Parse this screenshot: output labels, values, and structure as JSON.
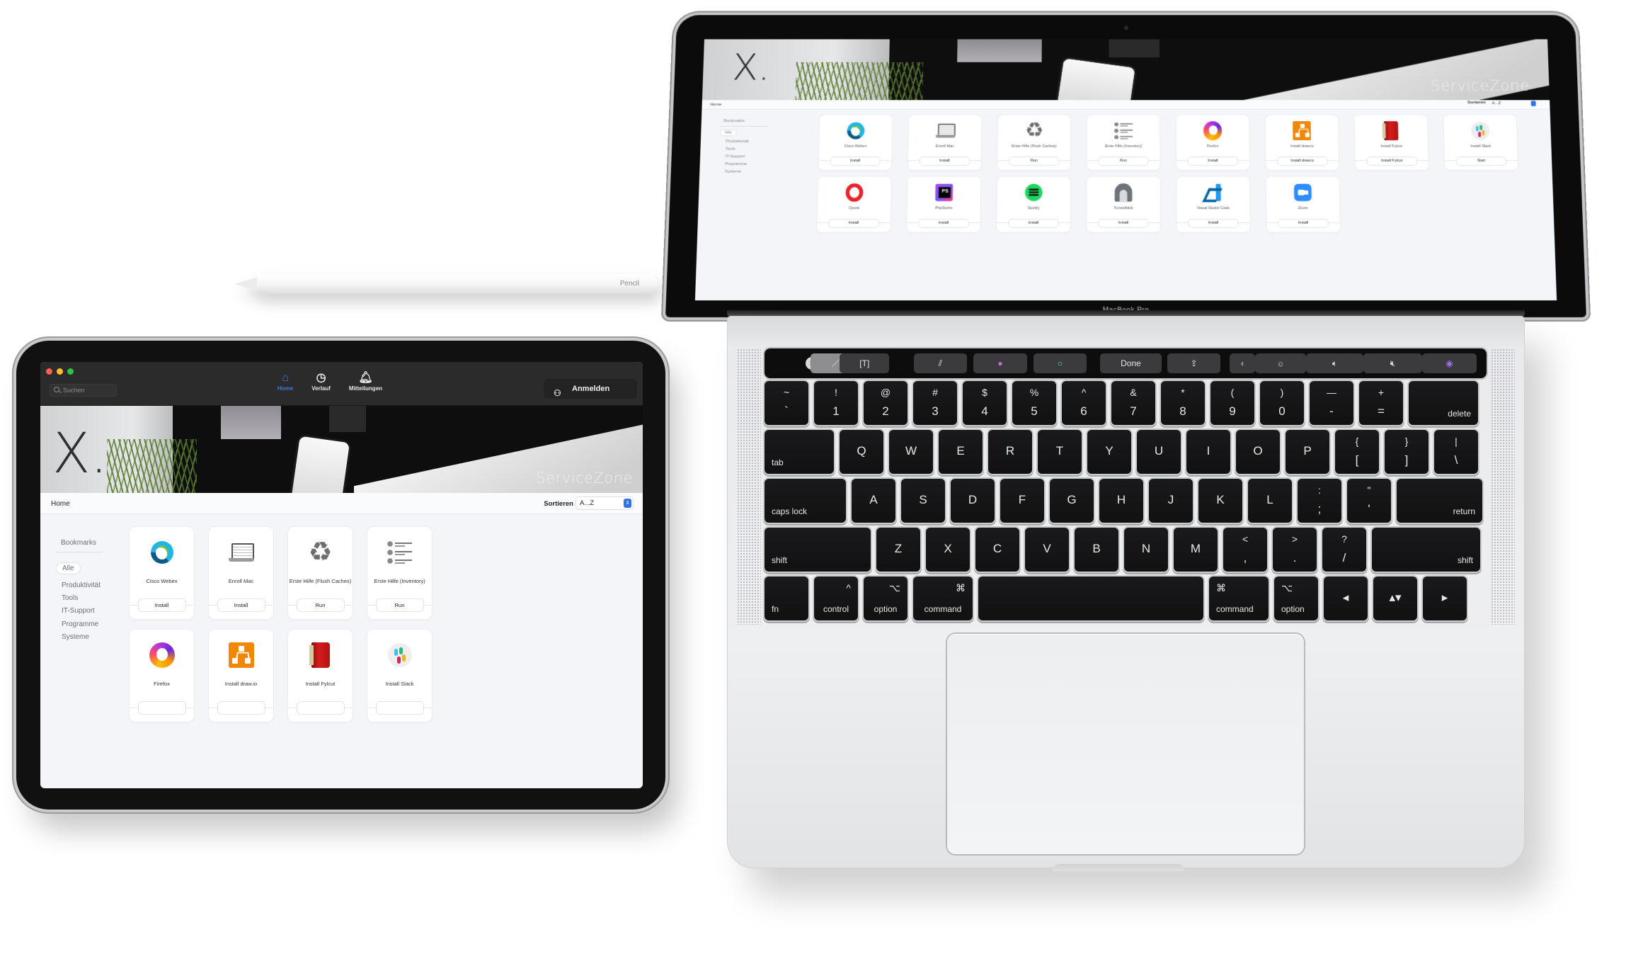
{
  "pencil": {
    "brand_label": "Pencil"
  },
  "ipad": {
    "window_controls": {
      "close_color": "#ff5f57",
      "minimize_color": "#febc2e",
      "maximize_color": "#28c840"
    },
    "search": {
      "placeholder": "Suchen",
      "value": ""
    },
    "nav": [
      {
        "label": "Home",
        "icon": "house-icon",
        "glyph": "⌂",
        "active": true
      },
      {
        "label": "Verlauf",
        "icon": "history-icon",
        "glyph": "◷",
        "active": false
      },
      {
        "label": "Mitteilungen",
        "icon": "bell-icon",
        "glyph": "🔔︎",
        "active": false
      }
    ],
    "login_button": {
      "label": "Anmelden",
      "icon_glyph": "⚇"
    },
    "banner": {
      "logo": "X.",
      "brand": "ServiceZone"
    },
    "breadcrumb": "Home",
    "sort": {
      "label": "Sortieren",
      "value": "A...Z",
      "stepper_glyph": "⇕"
    },
    "sidebar": {
      "heading": "Bookmarks",
      "items": [
        {
          "label": "Alle",
          "active": true
        },
        {
          "label": "Produktivität",
          "active": false
        },
        {
          "label": "Tools",
          "active": false
        },
        {
          "label": "IT-Support",
          "active": false
        },
        {
          "label": "Programme",
          "active": false
        },
        {
          "label": "Systeme",
          "active": false
        }
      ]
    },
    "apps": [
      {
        "name": "Cisco Webex",
        "icon": "webex",
        "action": "Install"
      },
      {
        "name": "Enroll Mac",
        "icon": "laptop",
        "action": "Install"
      },
      {
        "name": "Erste Hilfe (Flush Caches)",
        "icon": "recycle",
        "action": "Run"
      },
      {
        "name": "Erste Hilfe (Inventory)",
        "icon": "checklist",
        "action": "Run"
      },
      {
        "name": "Firefox",
        "icon": "firefox",
        "action": ""
      },
      {
        "name": "Install draw.io",
        "icon": "drawio",
        "action": ""
      },
      {
        "name": "Install Fylcut",
        "icon": "fylcut",
        "action": ""
      },
      {
        "name": "Install Slack",
        "icon": "slack",
        "action": ""
      }
    ]
  },
  "macbook": {
    "model_label": "MacBook Pro",
    "screen": {
      "banner": {
        "logo": "X.",
        "brand": "ServiceZone"
      },
      "breadcrumb": "Home",
      "sort": {
        "label": "Sortieren",
        "value": "A...Z"
      },
      "sidebar": {
        "heading": "Bookmarks",
        "items": [
          {
            "label": "Alle",
            "active": true
          },
          {
            "label": "Produktivität",
            "active": false
          },
          {
            "label": "Tools",
            "active": false
          },
          {
            "label": "IT-Support",
            "active": false
          },
          {
            "label": "Programme",
            "active": false
          },
          {
            "label": "Systeme",
            "active": false
          }
        ]
      },
      "apps": [
        {
          "name": "Cisco Webex",
          "icon": "webex",
          "action": "Install"
        },
        {
          "name": "Enroll Mac",
          "icon": "laptop",
          "action": "Install"
        },
        {
          "name": "Erste Hilfe (Flush Caches)",
          "icon": "recycle",
          "action": "Run"
        },
        {
          "name": "Erste Hilfe (Inventory)",
          "icon": "checklist",
          "action": "Run"
        },
        {
          "name": "Firefox",
          "icon": "firefox",
          "action": "Install"
        },
        {
          "name": "Install draw.io",
          "icon": "drawio",
          "action": "Install draw.io"
        },
        {
          "name": "Install Fylcut",
          "icon": "fylcut",
          "action": "Install Fylcut"
        },
        {
          "name": "Install Slack",
          "icon": "slack",
          "action": "Start"
        },
        {
          "name": "Opera",
          "icon": "opera",
          "action": "Install"
        },
        {
          "name": "PhpStorm",
          "icon": "phpstorm",
          "action": "Install"
        },
        {
          "name": "Spotify",
          "icon": "spotify",
          "action": "Install"
        },
        {
          "name": "Tunnelblick",
          "icon": "tunnel",
          "action": "Install"
        },
        {
          "name": "Visual Studio Code",
          "icon": "vscode",
          "action": "Install"
        },
        {
          "name": "Zoom",
          "icon": "zoom",
          "action": "Install"
        }
      ]
    },
    "touchbar": {
      "close_glyph": "×",
      "buttons": [
        {
          "name": "brush",
          "glyph": "／",
          "active": true
        },
        {
          "name": "text",
          "glyph": "[T]"
        },
        {
          "name": "stroke-style",
          "glyph": "⫽"
        },
        {
          "name": "color-fill",
          "glyph": "●"
        },
        {
          "name": "color-stroke",
          "glyph": "○"
        },
        {
          "name": "done",
          "glyph": "Done"
        },
        {
          "name": "share",
          "glyph": "⇪"
        },
        {
          "name": "collapse",
          "glyph": "‹"
        },
        {
          "name": "brightness",
          "glyph": "☼"
        },
        {
          "name": "volume",
          "glyph": "🔈︎"
        },
        {
          "name": "mute",
          "glyph": "🔇︎"
        },
        {
          "name": "siri",
          "glyph": "◉"
        }
      ]
    },
    "keyboard": {
      "row1": [
        {
          "top": "~",
          "bot": "`"
        },
        {
          "top": "!",
          "bot": "1"
        },
        {
          "top": "@",
          "bot": "2"
        },
        {
          "top": "#",
          "bot": "3"
        },
        {
          "top": "$",
          "bot": "4"
        },
        {
          "top": "%",
          "bot": "5"
        },
        {
          "top": "^",
          "bot": "6"
        },
        {
          "top": "&",
          "bot": "7"
        },
        {
          "top": "*",
          "bot": "8"
        },
        {
          "top": "(",
          "bot": "9"
        },
        {
          "top": ")",
          "bot": "0"
        },
        {
          "top": "—",
          "bot": "-"
        },
        {
          "top": "+",
          "bot": "="
        },
        {
          "mod": "delete"
        }
      ],
      "row2": [
        {
          "mod": "tab"
        },
        {
          "main": "Q"
        },
        {
          "main": "W"
        },
        {
          "main": "E"
        },
        {
          "main": "R"
        },
        {
          "main": "T"
        },
        {
          "main": "Y"
        },
        {
          "main": "U"
        },
        {
          "main": "I"
        },
        {
          "main": "O"
        },
        {
          "main": "P"
        },
        {
          "top": "{",
          "bot": "["
        },
        {
          "top": "}",
          "bot": "]"
        },
        {
          "top": "|",
          "bot": "\\"
        }
      ],
      "row3": [
        {
          "mod": "caps lock"
        },
        {
          "main": "A"
        },
        {
          "main": "S"
        },
        {
          "main": "D"
        },
        {
          "main": "F"
        },
        {
          "main": "G"
        },
        {
          "main": "H"
        },
        {
          "main": "J"
        },
        {
          "main": "K"
        },
        {
          "main": "L"
        },
        {
          "top": ":",
          "bot": ";"
        },
        {
          "top": "\"",
          "bot": "'"
        },
        {
          "mod": "return"
        }
      ],
      "row4": [
        {
          "mod": "shift"
        },
        {
          "main": "Z"
        },
        {
          "main": "X"
        },
        {
          "main": "C"
        },
        {
          "main": "V"
        },
        {
          "main": "B"
        },
        {
          "main": "N"
        },
        {
          "main": "M"
        },
        {
          "top": "<",
          "bot": ","
        },
        {
          "top": ">",
          "bot": "."
        },
        {
          "top": "?",
          "bot": "/"
        },
        {
          "mod": "shift"
        }
      ],
      "row5": [
        {
          "mod": "fn"
        },
        {
          "mod": "control",
          "sym": "^"
        },
        {
          "mod": "option",
          "sym": "⌥"
        },
        {
          "mod": "command",
          "sym": "⌘"
        },
        {
          "mod": ""
        },
        {
          "mod": "command",
          "sym": "⌘"
        },
        {
          "mod": "option",
          "sym": "⌥"
        },
        {
          "main": "◂"
        },
        {
          "main": "▴▾"
        },
        {
          "main": "▸"
        }
      ]
    }
  }
}
